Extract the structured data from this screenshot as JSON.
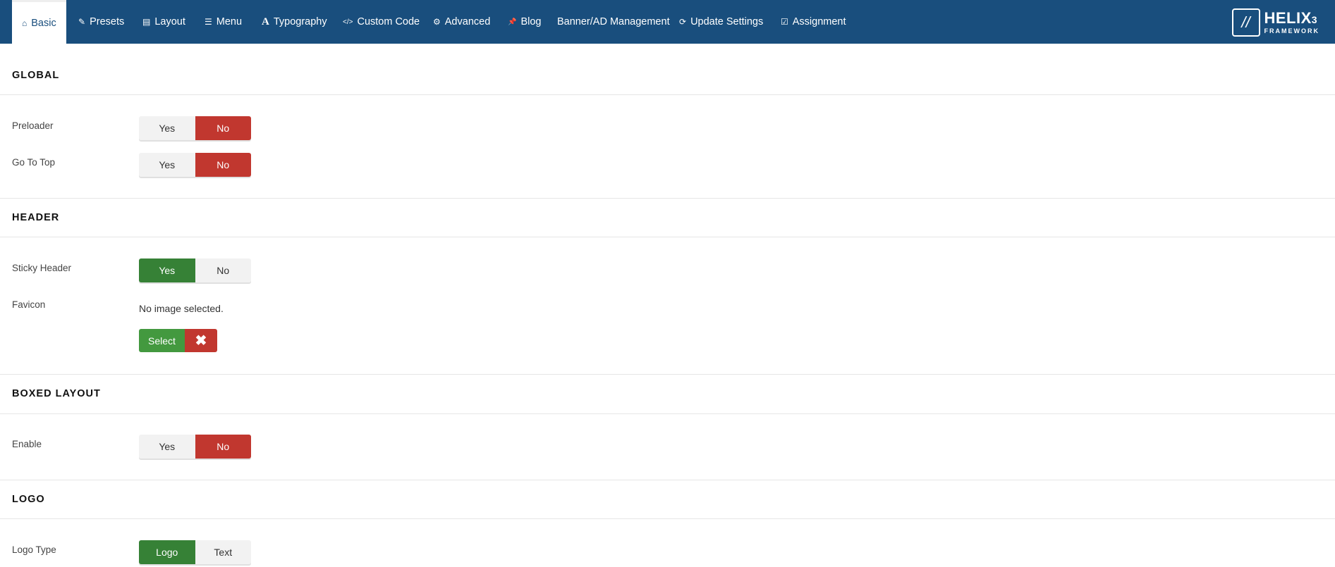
{
  "nav": {
    "tabs": [
      {
        "label": "Basic",
        "icon": "⌂"
      },
      {
        "label": "Presets",
        "icon": "✎"
      },
      {
        "label": "Layout",
        "icon": "▤"
      },
      {
        "label": "Menu",
        "icon": "☰"
      },
      {
        "label": "Typography",
        "icon": "A"
      },
      {
        "label": "Custom Code",
        "icon": "</>"
      },
      {
        "label": "Advanced",
        "icon": "⚙"
      },
      {
        "label": "Blog",
        "icon": "📌"
      },
      {
        "label": "Banner/AD Management",
        "icon": ""
      },
      {
        "label": "Update Settings",
        "icon": "⟳"
      },
      {
        "label": "Assignment",
        "icon": "☑"
      }
    ],
    "logo": {
      "title": "HELIX",
      "version": "3",
      "subtitle": "FRAMEWORK"
    }
  },
  "sections": {
    "global": "GLOBAL",
    "header": "HEADER",
    "boxed": "BOXED LAYOUT",
    "logo": "LOGO"
  },
  "fields": {
    "preloader": {
      "label": "Preloader",
      "yes": "Yes",
      "no": "No",
      "value": "No"
    },
    "gototop": {
      "label": "Go To Top",
      "yes": "Yes",
      "no": "No",
      "value": "No"
    },
    "sticky": {
      "label": "Sticky Header",
      "yes": "Yes",
      "no": "No",
      "value": "Yes"
    },
    "favicon": {
      "label": "Favicon",
      "status": "No image selected.",
      "select": "Select",
      "clear": "✖"
    },
    "boxed": {
      "label": "Enable",
      "yes": "Yes",
      "no": "No",
      "value": "No"
    },
    "logotype": {
      "label": "Logo Type",
      "opt1": "Logo",
      "opt2": "Text",
      "value": "Logo"
    }
  }
}
